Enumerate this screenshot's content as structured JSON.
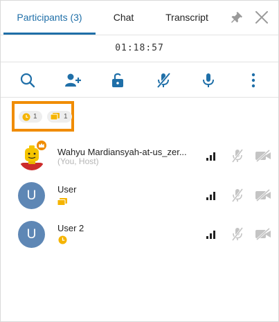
{
  "tabs": {
    "participants": "Participants (3)",
    "chat": "Chat",
    "transcript": "Transcript"
  },
  "timer": "01:18:57",
  "toolbar": {
    "icons": [
      "search-icon",
      "add-user-icon",
      "unlock-icon",
      "mic-off-icon",
      "mic-icon",
      "more-vertical-icon"
    ],
    "accent": "#1f6fa8"
  },
  "filters": {
    "clock_count": "1",
    "card_count": "1",
    "highlight_color": "#f08c00"
  },
  "participants": [
    {
      "name": "Wahyu Mardiansyah-at-us_zer...",
      "subtitle": "(You, Host)",
      "avatar": "lego-avatar",
      "badge": "host-crown-icon"
    },
    {
      "name": "User",
      "avatar_letter": "U",
      "status_icon": "card-icon"
    },
    {
      "name": "User 2",
      "avatar_letter": "U",
      "status_icon": "clock-icon"
    }
  ],
  "colors": {
    "avatar_bg": "#5e87b5",
    "status_yellow": "#f5b400",
    "muted_gray": "#b5b5b5"
  }
}
